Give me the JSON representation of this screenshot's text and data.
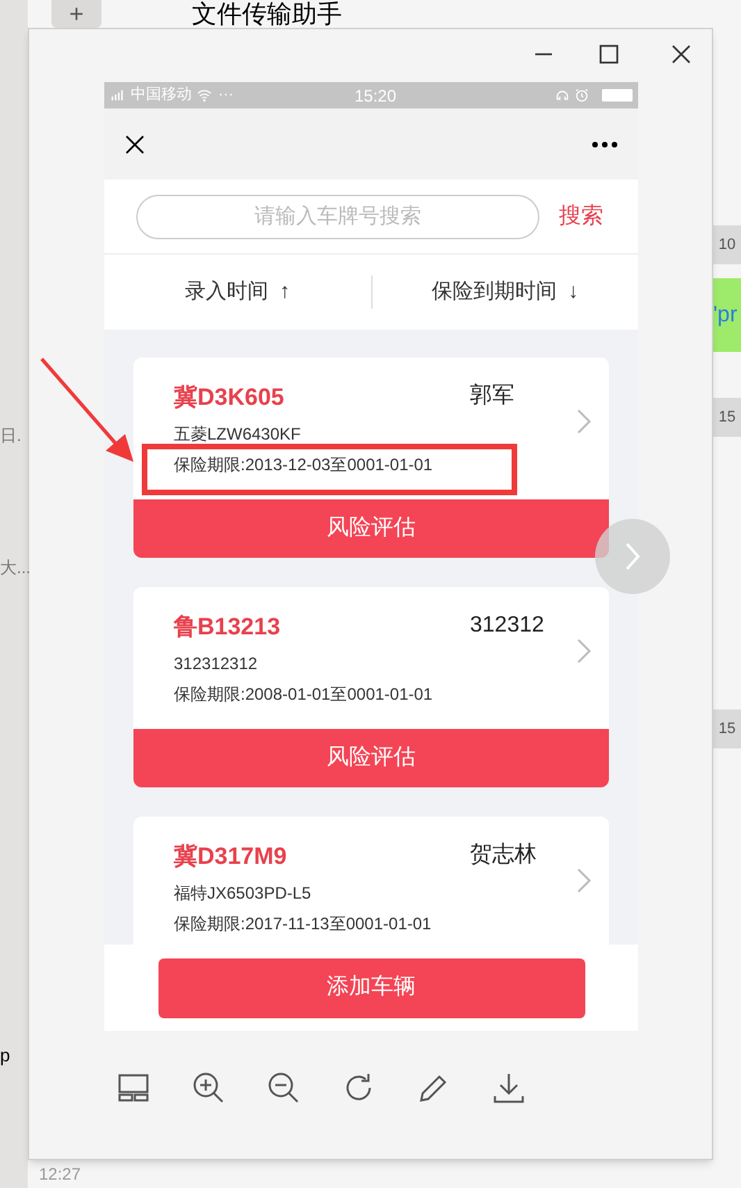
{
  "background_app": {
    "title": "文件传输助手",
    "add_button": "+",
    "list_snippets": [
      "日.",
      "大...",
      "p"
    ],
    "list_time": "12:27",
    "timestamps": [
      "10",
      "15",
      "15"
    ],
    "bubble": "'pr"
  },
  "phone": {
    "status_bar": {
      "carrier": "中国移动",
      "dots": "···",
      "time": "15:20"
    },
    "search": {
      "placeholder": "请输入车牌号搜索",
      "button": "搜索"
    },
    "sort": [
      {
        "label": "录入时间",
        "arrow": "↑"
      },
      {
        "label": "保险到期时间",
        "arrow": "↓"
      }
    ],
    "cards": [
      {
        "plate": "冀D3K605",
        "owner": "郭军",
        "model": "五菱LZW6430KF",
        "period": "保险期限:2013-12-03至0001-01-01",
        "button": "风险评估",
        "highlighted": true
      },
      {
        "plate": "鲁B13213",
        "owner": "312312",
        "model": "312312312",
        "period": "保险期限:2008-01-01至0001-01-01",
        "button": "风险评估",
        "highlighted": false
      },
      {
        "plate": "冀D317M9",
        "owner": "贺志林",
        "model": "福特JX6503PD-L5",
        "period": "保险期限:2017-11-13至0001-01-01",
        "highlighted": false
      }
    ],
    "add_button": "添加车辆"
  }
}
